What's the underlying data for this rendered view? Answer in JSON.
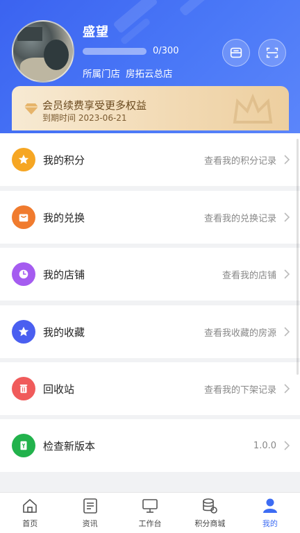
{
  "profile": {
    "name": "盛望",
    "points_progress": 0.0,
    "progress_text": "0/300",
    "store_label": "所属门店",
    "store_name": "房拓云总店"
  },
  "header_buttons": [
    {
      "icon": "card-scan-icon"
    },
    {
      "icon": "qr-scan-icon"
    }
  ],
  "vip": {
    "title": "会员续费享受更多权益",
    "expire": "到期时间 2023-06-21"
  },
  "menu": [
    {
      "label": "我的积分",
      "hint": "查看我的积分记录",
      "icon": "points-icon",
      "color": "#f6a623"
    },
    {
      "label": "我的兑换",
      "hint": "查看我的兑换记录",
      "icon": "bag-icon",
      "color": "#f07b2e"
    },
    {
      "label": "我的店铺",
      "hint": "查看我的店铺",
      "icon": "clock-icon",
      "color": "#a55cf0"
    },
    {
      "label": "我的收藏",
      "hint": "查看我收藏的房源",
      "icon": "star-icon",
      "color": "#4a5ff0"
    },
    {
      "label": "回收站",
      "hint": "查看我的下架记录",
      "icon": "trash-icon",
      "color": "#f05b5b"
    },
    {
      "label": "检查新版本",
      "hint": "1.0.0",
      "icon": "update-icon",
      "color": "#22b24c"
    }
  ],
  "tabs": [
    {
      "label": "首页",
      "icon": "home-icon"
    },
    {
      "label": "资讯",
      "icon": "news-icon"
    },
    {
      "label": "工作台",
      "icon": "monitor-icon"
    },
    {
      "label": "积分商城",
      "icon": "coins-icon"
    },
    {
      "label": "我的",
      "icon": "user-icon",
      "active": true
    }
  ],
  "colors": {
    "header": "#4a78f7",
    "accent": "#3d6cf3",
    "vip": "#f3dcb8"
  }
}
